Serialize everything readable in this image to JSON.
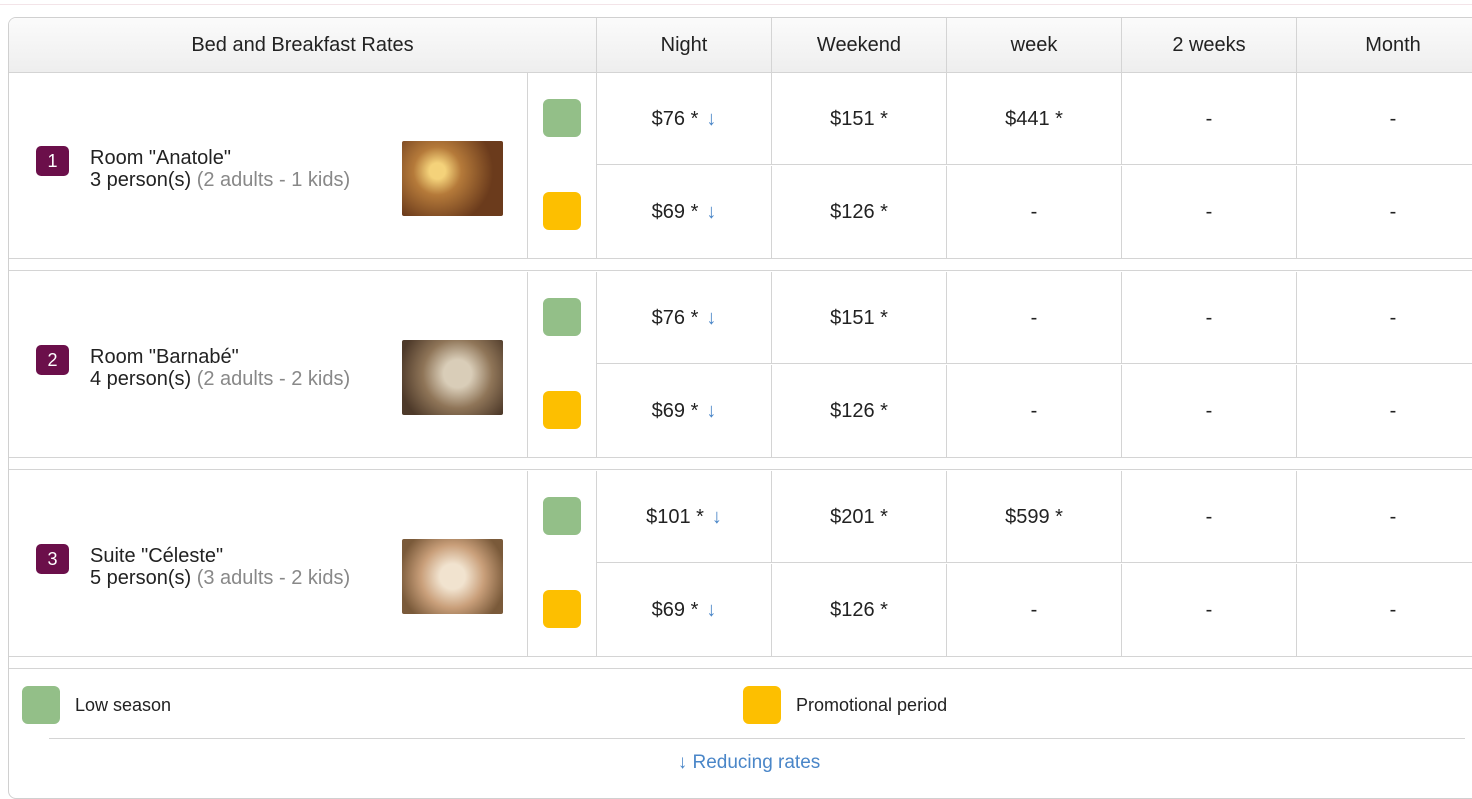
{
  "header": {
    "title": "Bed and Breakfast Rates",
    "columns": [
      "Night",
      "Weekend",
      "week",
      "2 weeks",
      "Month"
    ]
  },
  "colors": {
    "low": "#93bf88",
    "promo": "#fdbf00",
    "badge": "#6b0f4a",
    "arrow": "#4a86c8"
  },
  "rooms": [
    {
      "number": "1",
      "name": "Room \"Anatole\"",
      "persons": "3 person(s)",
      "composition": "(2 adults - 1 kids)",
      "rows": [
        {
          "season": "low",
          "cells": [
            "$76 *",
            "$151 *",
            "$441 *",
            "-",
            "-"
          ],
          "reducing": true
        },
        {
          "season": "promo",
          "cells": [
            "$69 *",
            "$126 *",
            "-",
            "-",
            "-"
          ],
          "reducing": true
        }
      ]
    },
    {
      "number": "2",
      "name": "Room \"Barnabé\"",
      "persons": "4 person(s)",
      "composition": "(2 adults - 2 kids)",
      "rows": [
        {
          "season": "low",
          "cells": [
            "$76 *",
            "$151 *",
            "-",
            "-",
            "-"
          ],
          "reducing": true
        },
        {
          "season": "promo",
          "cells": [
            "$69 *",
            "$126 *",
            "-",
            "-",
            "-"
          ],
          "reducing": true
        }
      ]
    },
    {
      "number": "3",
      "name": "Suite \"Céleste\"",
      "persons": "5 person(s)",
      "composition": "(3 adults - 2 kids)",
      "rows": [
        {
          "season": "low",
          "cells": [
            "$101 *",
            "$201 *",
            "$599 *",
            "-",
            "-"
          ],
          "reducing": true
        },
        {
          "season": "promo",
          "cells": [
            "$69 *",
            "$126 *",
            "-",
            "-",
            "-"
          ],
          "reducing": true
        }
      ]
    }
  ],
  "legend": {
    "low_label": "Low season",
    "promo_label": "Promotional period",
    "reducing_arrow": "↓",
    "reducing_label": "Reducing rates"
  }
}
